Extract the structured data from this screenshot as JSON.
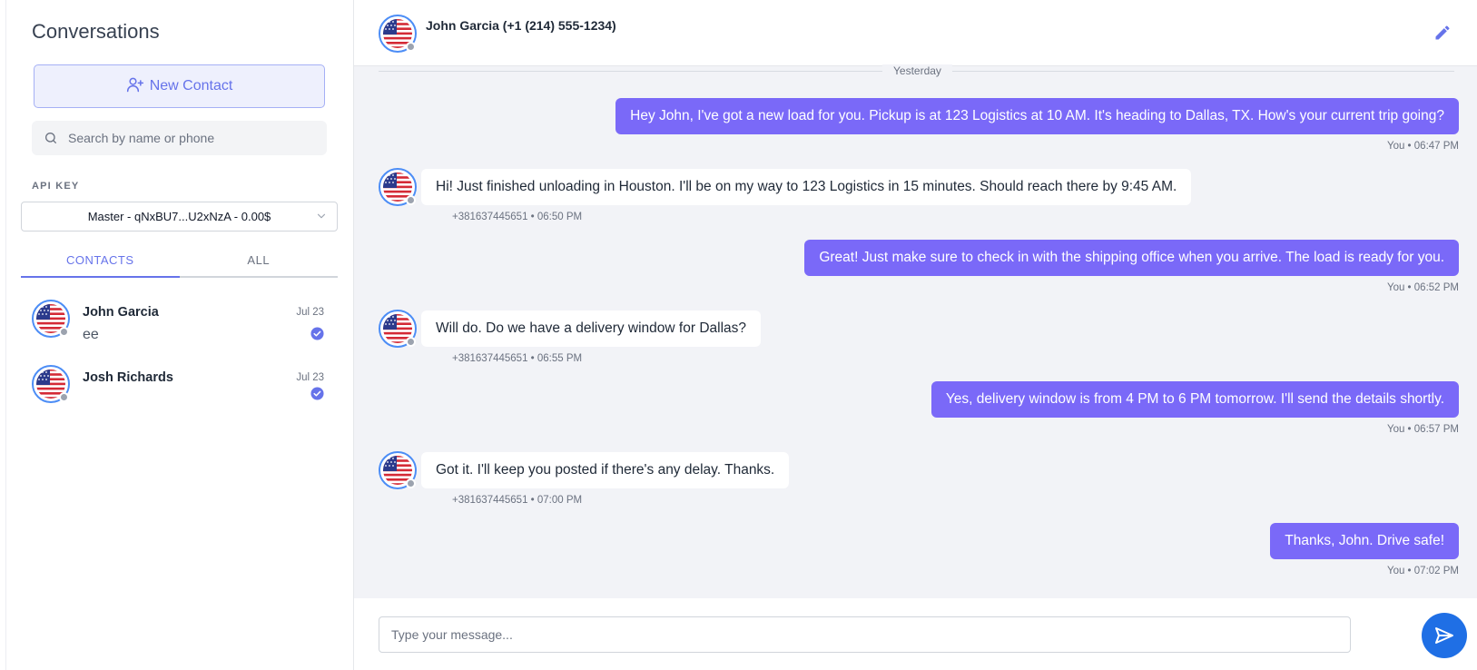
{
  "sidebar": {
    "title": "Conversations",
    "new_contact_label": "New Contact",
    "search_placeholder": "Search by name or phone",
    "api_key_label": "API KEY",
    "api_key_selected": "Master - qNxBU7...U2xNzA - 0.00$",
    "tabs": [
      {
        "label": "CONTACTS",
        "active": true
      },
      {
        "label": "ALL",
        "active": false
      }
    ],
    "contacts": [
      {
        "name": "John Garcia",
        "preview": "ee",
        "date": "Jul 23",
        "icon": "flag-us-icon"
      },
      {
        "name": "Josh Richards",
        "preview": "",
        "date": "Jul 23",
        "icon": "flag-us-icon"
      }
    ]
  },
  "chat": {
    "title": "John Garcia (+1 (214) 555-1234)",
    "day_divider": "Yesterday",
    "messages": [
      {
        "direction": "out",
        "text": "Hey John, I've got a new load for you. Pickup is at 123 Logistics at 10 AM. It's heading to Dallas, TX. How's your current trip going?",
        "meta": "You • 06:47 PM"
      },
      {
        "direction": "in",
        "text": "Hi! Just finished unloading in Houston. I'll be on my way to 123 Logistics in 15 minutes. Should reach there by 9:45 AM.",
        "meta": "+381637445651 • 06:50 PM"
      },
      {
        "direction": "out",
        "text": "Great! Just make sure to check in with the shipping office when you arrive. The load is ready for you.",
        "meta": "You • 06:52 PM"
      },
      {
        "direction": "in",
        "text": "Will do. Do we have a delivery window for Dallas?",
        "meta": "+381637445651 • 06:55 PM"
      },
      {
        "direction": "out",
        "text": "Yes, delivery window is from 4 PM to 6 PM tomorrow. I'll send the details shortly.",
        "meta": "You • 06:57 PM"
      },
      {
        "direction": "in",
        "text": "Got it. I'll keep you posted if there's any delay. Thanks.",
        "meta": "+381637445651 • 07:00 PM"
      },
      {
        "direction": "out",
        "text": "Thanks, John. Drive safe!",
        "meta": "You • 07:02 PM"
      }
    ],
    "composer_placeholder": "Type your message..."
  },
  "colors": {
    "accent": "#6673ea",
    "outgoing_bubble": "#7a69f8",
    "send_button": "#1f6fe5",
    "avatar_ring": "#4c8df6"
  }
}
